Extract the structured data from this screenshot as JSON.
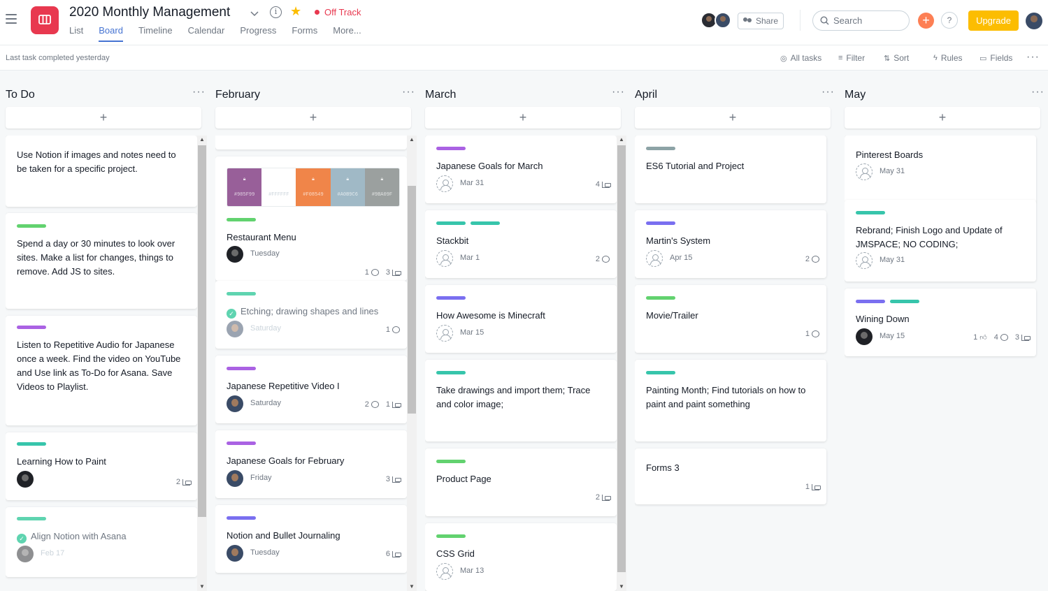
{
  "project": {
    "title": "2020 Monthly Management",
    "status": "Off Track"
  },
  "nav": {
    "tabs": [
      "List",
      "Board",
      "Timeline",
      "Calendar",
      "Progress",
      "Forms",
      "More..."
    ],
    "active_tab": "Board"
  },
  "header": {
    "share_label": "Share",
    "search_placeholder": "Search",
    "help_label": "?",
    "upgrade_label": "Upgrade"
  },
  "toolbar": {
    "last_task": "Last task completed yesterday",
    "all_tasks": "All tasks",
    "filter": "Filter",
    "sort": "Sort",
    "rules": "Rules",
    "fields": "Fields"
  },
  "colors": {
    "accent": "#4573d2",
    "status_red": "#e8384f",
    "upgrade": "#fcbd01",
    "tag_green": "#62d26f",
    "tag_purple": "#aa62e3",
    "tag_teal": "#37c5ab",
    "tag_indigo": "#7a6ff0",
    "tag_gray": "#8da3a6",
    "tag_mint": "#5fd4b0"
  },
  "columns": [
    {
      "title": "To Do",
      "cards": [
        {
          "title": "Use Notion if images and notes need to be taken for a specific project.",
          "tags": [],
          "assignee": "",
          "due": "",
          "comments": "",
          "subtasks": "",
          "likes": ""
        },
        {
          "title": "Spend a day or 30 minutes to look over sites. Make a list for changes, things to remove. Add JS to sites.",
          "tags": [
            "tag_green"
          ],
          "assignee": "",
          "due": "",
          "comments": "",
          "subtasks": "",
          "likes": ""
        },
        {
          "title": "Listen to Repetitive Audio for Japanese once a week. Find the video on YouTube and Use link as To-Do for Asana. Save Videos to Playlist.",
          "tags": [
            "tag_purple"
          ],
          "assignee": "",
          "due": "",
          "comments": "",
          "subtasks": "",
          "likes": ""
        },
        {
          "title": "Learning How to Paint",
          "tags": [
            "tag_teal"
          ],
          "assignee": "dark",
          "due": "",
          "comments": "",
          "subtasks": "2",
          "likes": ""
        },
        {
          "title": "Align Notion with Asana",
          "tags": [
            "tag_mint"
          ],
          "assignee": "dark-faded",
          "due": "Feb 17",
          "comments": "",
          "subtasks": "",
          "likes": "",
          "completed": true
        }
      ]
    },
    {
      "title": "February",
      "cards": [
        {
          "title": "Restaurant Menu",
          "tags": [
            "tag_green"
          ],
          "assignee": "dark",
          "due": "Tuesday",
          "comments": "1",
          "subtasks": "3",
          "likes": "",
          "palette": [
            "#985F99",
            "#FFFFFF",
            "#F08549",
            "#A0B9C6",
            "#9BA09F"
          ]
        },
        {
          "title": "Etching; drawing shapes and lines",
          "tags": [
            "tag_mint"
          ],
          "assignee": "photo-faded",
          "due": "Saturday",
          "comments": "1",
          "subtasks": "",
          "likes": "",
          "completed": true
        },
        {
          "title": "Japanese Repetitive Video I",
          "tags": [
            "tag_purple"
          ],
          "assignee": "photo",
          "due": "Saturday",
          "comments": "2",
          "subtasks": "1",
          "likes": ""
        },
        {
          "title": "Japanese Goals for February",
          "tags": [
            "tag_purple"
          ],
          "assignee": "photo",
          "due": "Friday",
          "comments": "",
          "subtasks": "3",
          "likes": ""
        },
        {
          "title": "Notion and Bullet Journaling",
          "tags": [
            "tag_indigo"
          ],
          "assignee": "photo",
          "due": "Tuesday",
          "comments": "",
          "subtasks": "6",
          "likes": ""
        }
      ]
    },
    {
      "title": "March",
      "cards": [
        {
          "title": "Japanese Goals for March",
          "tags": [
            "tag_purple"
          ],
          "assignee": "empty",
          "due": "Mar 31",
          "comments": "",
          "subtasks": "4",
          "likes": ""
        },
        {
          "title": "Stackbit",
          "tags": [
            "tag_teal",
            "tag_teal"
          ],
          "assignee": "empty",
          "due": "Mar 1",
          "comments": "2",
          "subtasks": "",
          "likes": ""
        },
        {
          "title": "How Awesome is Minecraft",
          "tags": [
            "tag_indigo"
          ],
          "assignee": "empty",
          "due": "Mar 15",
          "comments": "",
          "subtasks": "",
          "likes": ""
        },
        {
          "title": "Take drawings and import them; Trace and color image;",
          "tags": [
            "tag_teal"
          ],
          "assignee": "",
          "due": "",
          "comments": "",
          "subtasks": "",
          "likes": ""
        },
        {
          "title": "Product Page",
          "tags": [
            "tag_green"
          ],
          "assignee": "",
          "due": "",
          "comments": "",
          "subtasks": "2",
          "likes": ""
        },
        {
          "title": "CSS Grid",
          "tags": [
            "tag_green"
          ],
          "assignee": "empty",
          "due": "Mar 13",
          "comments": "",
          "subtasks": "",
          "likes": ""
        }
      ]
    },
    {
      "title": "April",
      "cards": [
        {
          "title": "ES6 Tutorial and Project",
          "tags": [
            "tag_gray"
          ],
          "assignee": "",
          "due": "",
          "comments": "",
          "subtasks": "",
          "likes": ""
        },
        {
          "title": "Martin's System",
          "tags": [
            "tag_indigo"
          ],
          "assignee": "empty",
          "due": "Apr 15",
          "comments": "2",
          "subtasks": "",
          "likes": ""
        },
        {
          "title": "Movie/Trailer",
          "tags": [
            "tag_green"
          ],
          "assignee": "",
          "due": "",
          "comments": "1",
          "subtasks": "",
          "likes": ""
        },
        {
          "title": "Painting Month; Find tutorials on how to paint and paint something",
          "tags": [
            "tag_teal"
          ],
          "assignee": "",
          "due": "",
          "comments": "",
          "subtasks": "",
          "likes": ""
        },
        {
          "title": "Forms 3",
          "tags": [],
          "assignee": "",
          "due": "",
          "comments": "",
          "subtasks": "1",
          "likes": ""
        }
      ]
    },
    {
      "title": "May",
      "cards": [
        {
          "title": "Pinterest Boards",
          "tags": [],
          "assignee": "empty",
          "due": "May 31",
          "comments": "",
          "subtasks": "",
          "likes": ""
        },
        {
          "title": "Rebrand; Finish Logo and Update of JMSPACE; NO CODING;",
          "tags": [
            "tag_teal"
          ],
          "assignee": "empty",
          "due": "May 31",
          "comments": "",
          "subtasks": "",
          "likes": ""
        },
        {
          "title": "Wining Down",
          "tags": [
            "tag_indigo",
            "tag_teal"
          ],
          "assignee": "dark",
          "due": "May 15",
          "comments": "4",
          "subtasks": "3",
          "likes": "1"
        }
      ]
    }
  ]
}
